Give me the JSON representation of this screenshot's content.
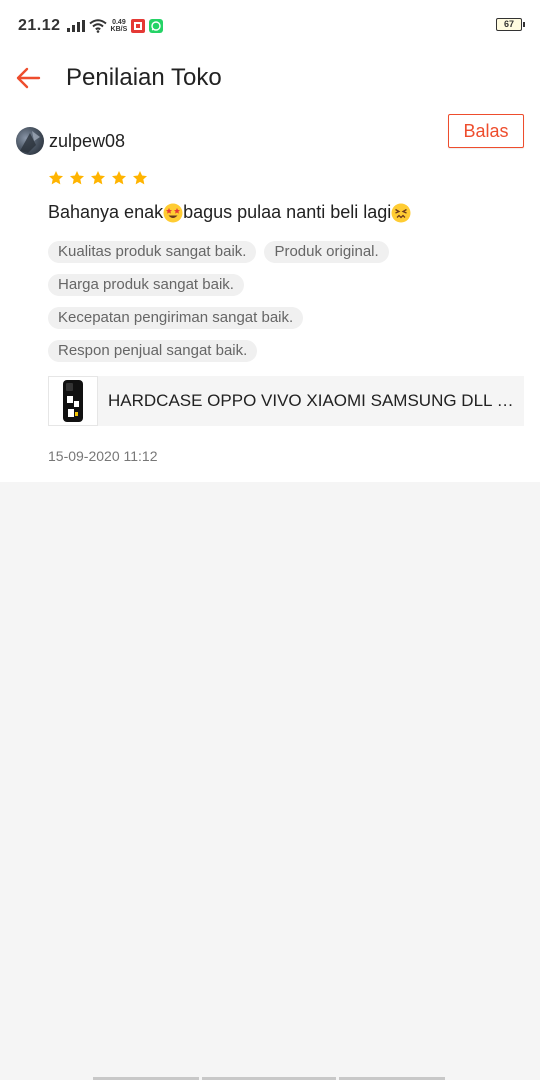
{
  "status_bar": {
    "time": "21.12",
    "net_speed_value": "0.49",
    "net_speed_unit": "KB/S",
    "battery": "67"
  },
  "header": {
    "title": "Penilaian Toko",
    "accent_color": "#ee4d2d"
  },
  "review": {
    "username": "zulpew08",
    "reply_label": "Balas",
    "rating": 5,
    "rating_max": 5,
    "text_part1": "Bahanya enak",
    "text_part2": "bagus pulaa nanti beli lagi ",
    "tags": [
      "Kualitas produk sangat baik.",
      "Produk original.",
      "Harga produk sangat baik.",
      "Kecepatan pengiriman sangat baik.",
      "Respon penjual sangat baik."
    ],
    "product_name": "HARDCASE OPPO VIVO XIAOMI SAMSUNG DLL SI...",
    "timestamp": "15-09-2020 11:12"
  }
}
